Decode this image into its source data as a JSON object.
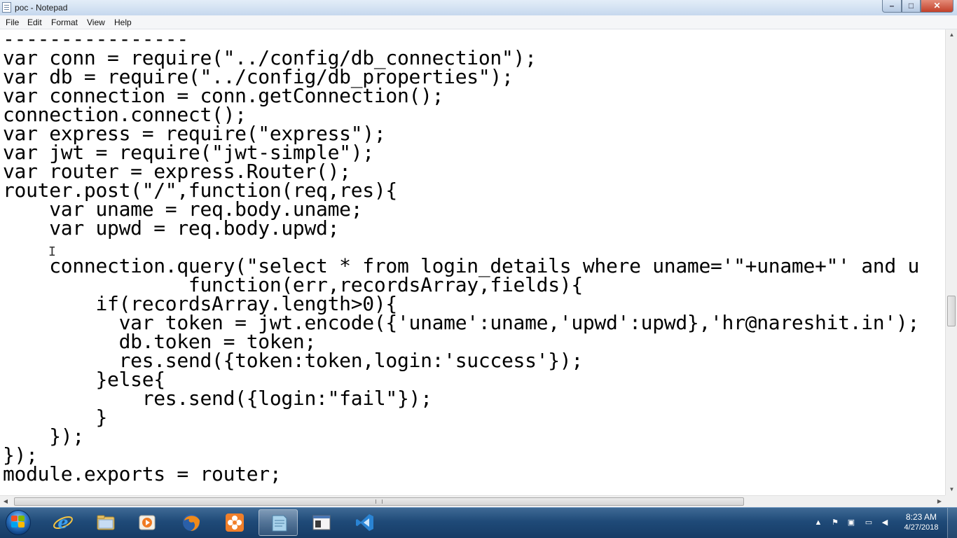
{
  "window": {
    "title": "poc - Notepad",
    "controls": {
      "minimize": "–",
      "maximize": "□",
      "close": "✕"
    }
  },
  "menu": [
    "File",
    "Edit",
    "Format",
    "View",
    "Help"
  ],
  "editor": {
    "lines": [
      "----------------",
      "var conn = require(\"../config/db_connection\");",
      "var db = require(\"../config/db_properties\");",
      "var connection = conn.getConnection();",
      "connection.connect();",
      "var express = require(\"express\");",
      "var jwt = require(\"jwt-simple\");",
      "var router = express.Router();",
      "router.post(\"/\",function(req,res){",
      "    var uname = req.body.uname;",
      "    var upwd = req.body.upwd;",
      "",
      "    connection.query(\"select * from login_details where uname='\"+uname+\"' and u",
      "                function(err,recordsArray,fields){",
      "        if(recordsArray.length>0){",
      "          var token = jwt.encode({'uname':uname,'upwd':upwd},'hr@nareshit.in');",
      "          db.token = token;",
      "          res.send({token:token,login:'success'});",
      "        }else{",
      "            res.send({login:\"fail\"});",
      "        }",
      "    });",
      "});",
      "module.exports = router;"
    ]
  },
  "taskbar": {
    "apps": [
      {
        "name": "internet-explorer-icon",
        "active": false
      },
      {
        "name": "file-explorer-icon",
        "active": false
      },
      {
        "name": "media-player-icon",
        "active": false
      },
      {
        "name": "firefox-icon",
        "active": false
      },
      {
        "name": "flower-app-icon",
        "active": false
      },
      {
        "name": "notepad-icon",
        "active": true
      },
      {
        "name": "console-window-icon",
        "active": false
      },
      {
        "name": "visual-studio-code-icon",
        "active": false
      }
    ],
    "tray": [
      "show-hidden-icons",
      "action-center-flag-icon",
      "device-icon",
      "network-icon",
      "volume-icon"
    ],
    "clock": {
      "time": "8:23 AM",
      "date": "4/27/2018"
    }
  },
  "colors": {
    "titlebar": "#c6d8ee",
    "taskbar": "#1f4a78",
    "close_button": "#c2402a"
  }
}
